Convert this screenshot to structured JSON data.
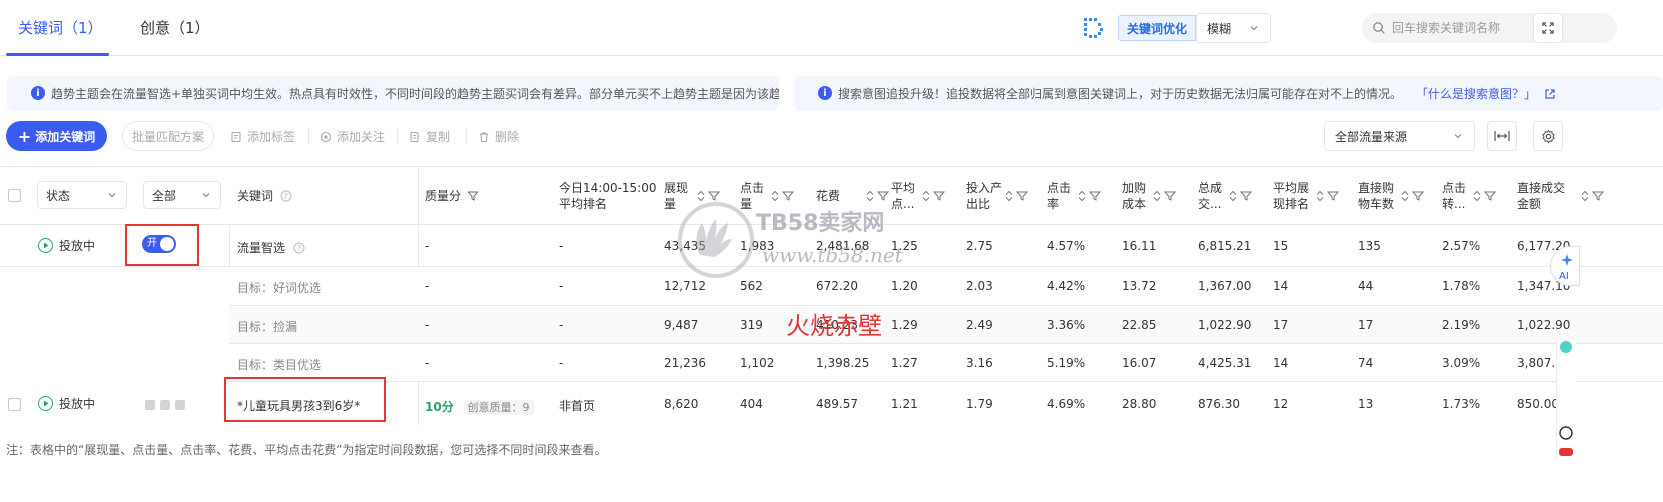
{
  "tabs": [
    {
      "label": "关键词（1）",
      "active": true
    },
    {
      "label": "创意（1）",
      "active": false
    }
  ],
  "header": {
    "optimize_label": "关键词优化",
    "match_mode": "模糊",
    "search_placeholder": "回车搜索关键词名称"
  },
  "notices": [
    {
      "text": "趋势主题会在流量智选+单独买词中均生效。热点具有时效性，不同时间段的趋势主题买词会有差异。部分单元买不上趋势主题是因为该趋势..."
    },
    {
      "text": "搜索意图追投升级！追投数据将全部归属到意图关键词上，对于历史数据无法归属可能存在对不上的情况。",
      "link": "「什么是搜索意图？」"
    }
  ],
  "toolbar": {
    "add_keyword": "添加关键词",
    "batch_match": "批量匹配方案",
    "add_tag": "添加标签",
    "add_follow": "添加关注",
    "copy": "复制",
    "delete": "删除",
    "traffic_source": "全部流量来源"
  },
  "table": {
    "filters": {
      "status": "状态",
      "all": "全部"
    },
    "headers": {
      "keyword": "关键词",
      "quality": "质量分",
      "rank_line1": "今日14:00-15:00",
      "rank_line2": "平均排名",
      "c1a": "展现",
      "c1b": "量",
      "c2a": "点击",
      "c2b": "量",
      "c3": "花费",
      "c4a": "平均",
      "c4b": "点...",
      "c5a": "投入产",
      "c5b": "出比",
      "c6a": "点击",
      "c6b": "率",
      "c7a": "加购",
      "c7b": "成本",
      "c8a": "总成",
      "c8b": "交...",
      "c9a": "平均展",
      "c9b": "现排名",
      "c10a": "直接购",
      "c10b": "物车数",
      "c11a": "点击",
      "c11b": "转...",
      "c12a": "直接成交",
      "c12b": "金额"
    },
    "rows": [
      {
        "status": "投放中",
        "toggle": "开",
        "keyword": "流量智选",
        "quality": "-",
        "rank": "-",
        "vals": [
          "43,435",
          "1,983",
          "2,481.68",
          "1.25",
          "2.75",
          "4.57%",
          "16.11",
          "6,815.21",
          "15",
          "135",
          "2.57%",
          "6,177.20"
        ]
      },
      {
        "keyword": "目标：好词优选",
        "quality": "-",
        "rank": "-",
        "vals": [
          "12,712",
          "562",
          "672.20",
          "1.20",
          "2.03",
          "4.42%",
          "13.72",
          "1,367.00",
          "14",
          "44",
          "1.78%",
          "1,347.10"
        ]
      },
      {
        "keyword": "目标：捡漏",
        "quality": "-",
        "rank": "-",
        "vals": [
          "9,487",
          "319",
          "410.23",
          "1.29",
          "2.49",
          "3.36%",
          "22.85",
          "1,022.90",
          "17",
          "17",
          "2.19%",
          "1,022.90"
        ]
      },
      {
        "keyword": "目标：类目优选",
        "quality": "-",
        "rank": "-",
        "vals": [
          "21,236",
          "1,102",
          "1,398.25",
          "1.27",
          "3.16",
          "5.19%",
          "16.07",
          "4,425.31",
          "14",
          "74",
          "3.09%",
          "3,807.12"
        ]
      },
      {
        "status": "投放中",
        "keyword": "*儿童玩具男孩3到6岁*",
        "quality_score": "10分",
        "creative_quality": "创意质量：9",
        "rank": "非首页",
        "vals": [
          "8,620",
          "404",
          "489.57",
          "1.21",
          "1.79",
          "4.69%",
          "28.80",
          "876.30",
          "12",
          "13",
          "1.73%",
          "850.00"
        ]
      }
    ]
  },
  "watermark": {
    "site": "TB58卖家网",
    "url": "www.tb58.net",
    "overlay": "火烧赤壁"
  },
  "edge": {
    "ai": "AI"
  },
  "footnote": "注：表格中的“展现量、点击量、点击率、花费、平均点击花费”为指定时间段数据，您可选择不同时间段来查看。",
  "colors": {
    "primary": "#3a5cf0",
    "success": "#2aa36b",
    "highlight": "#e33636"
  }
}
